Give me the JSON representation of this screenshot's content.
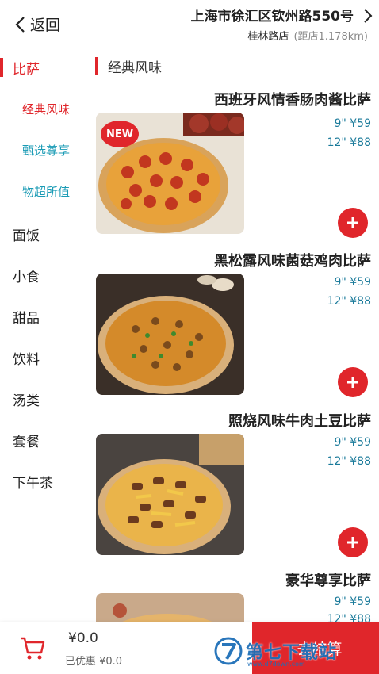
{
  "header": {
    "back_label": "返回",
    "address": "上海市徐汇区钦州路550号",
    "store_name": "桂林路店",
    "store_distance": "(距店1.178km)"
  },
  "sidebar": {
    "categories": [
      {
        "label": "比萨",
        "active": true
      },
      {
        "label": "面饭"
      },
      {
        "label": "小食"
      },
      {
        "label": "甜品"
      },
      {
        "label": "饮料"
      },
      {
        "label": "汤类"
      },
      {
        "label": "套餐"
      },
      {
        "label": "下午茶"
      }
    ],
    "subcategories": [
      {
        "label": "经典风味",
        "active": true
      },
      {
        "label": "甄选尊享"
      },
      {
        "label": "物超所值"
      }
    ]
  },
  "section": {
    "title": "经典风味"
  },
  "products": [
    {
      "name": "西班牙风情香肠肉酱比萨",
      "price_9": "9\" ¥59",
      "price_12": "12\" ¥88",
      "badge": "NEW"
    },
    {
      "name": "黑松露风味菌菇鸡肉比萨",
      "price_9": "9\" ¥59",
      "price_12": "12\" ¥88"
    },
    {
      "name": "照烧风味牛肉土豆比萨",
      "price_9": "9\" ¥59",
      "price_12": "12\" ¥88"
    },
    {
      "name": "豪华尊享比萨",
      "price_9": "9\" ¥59",
      "price_12": "12\" ¥88"
    }
  ],
  "cart": {
    "total": "¥0.0",
    "discount": "已优惠 ¥0.0",
    "checkout_label": "去结算"
  },
  "watermark": {
    "text": "第七下载站",
    "url": "www.d7down.com"
  },
  "colors": {
    "accent": "#e0262b",
    "subcategory": "#1a9bb5",
    "price": "#1a7a9a"
  }
}
